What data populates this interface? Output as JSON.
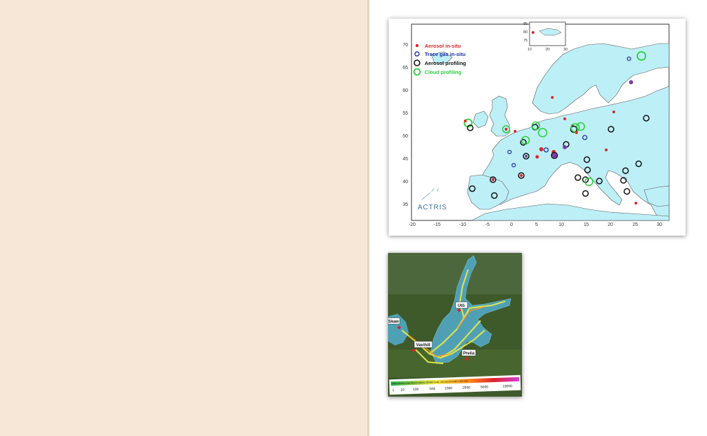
{
  "europe_map": {
    "legend": [
      {
        "label": "Aerosol in-situ",
        "color": "#d9262a"
      },
      {
        "label": "Trace gas in-situ",
        "color": "#1f2ea8"
      },
      {
        "label": "Aerosol profiling",
        "color": "#111111"
      },
      {
        "label": "Cloud profiling",
        "color": "#2ad13a"
      }
    ],
    "logo_text": "ACTRIS",
    "x_ticks": [
      "-20",
      "-15",
      "-10",
      "-5",
      "0",
      "5",
      "10",
      "15",
      "20",
      "25",
      "30"
    ],
    "y_ticks": [
      "70",
      "65",
      "60",
      "55",
      "50",
      "45",
      "40",
      "35"
    ],
    "inset_x_ticks": [
      "10",
      "20",
      "30"
    ],
    "inset_y_ticks": [
      "85",
      "80",
      "75"
    ],
    "colors": {
      "land": "#bdeff7",
      "frame": "#333333"
    }
  },
  "baltic_map": {
    "stations": [
      "Utö",
      "Skaw",
      "Vavihill",
      "Preila"
    ],
    "legend_caption": "ship emissions [kg/cell] according to STEAM model. Cell area at center: 1,301 km2",
    "scale_values": [
      "1",
      "10",
      "100",
      "500",
      "1000",
      "2500",
      "5000",
      "10000"
    ]
  }
}
